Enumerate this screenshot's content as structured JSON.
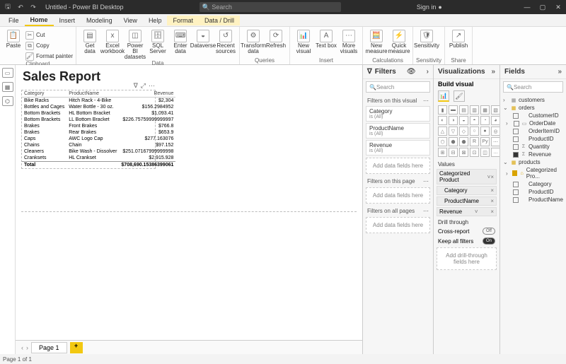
{
  "titlebar": {
    "title": "Untitled - Power BI Desktop",
    "search_placeholder": "Search",
    "signin": "Sign in"
  },
  "tabs": {
    "file": "File",
    "home": "Home",
    "insert": "Insert",
    "modeling": "Modeling",
    "view": "View",
    "help": "Help",
    "format": "Format",
    "datadrill": "Data / Drill"
  },
  "ribbon": {
    "clipboard": {
      "label": "Clipboard",
      "paste": "Paste",
      "cut": "Cut",
      "copy": "Copy",
      "fp": "Format painter"
    },
    "data": {
      "label": "Data",
      "get": "Get data",
      "excel": "Excel workbook",
      "pbids": "Power BI datasets",
      "sql": "SQL Server",
      "enter": "Enter data",
      "dv": "Dataverse",
      "recent": "Recent sources"
    },
    "queries": {
      "label": "Queries",
      "transform": "Transform data",
      "refresh": "Refresh"
    },
    "insert": {
      "label": "Insert",
      "newv": "New visual",
      "text": "Text box",
      "more": "More visuals"
    },
    "calc": {
      "label": "Calculations",
      "nm": "New measure",
      "qm": "Quick measure"
    },
    "sens": {
      "label": "Sensitivity",
      "btn": "Sensitivity"
    },
    "share": {
      "label": "Share",
      "pub": "Publish"
    }
  },
  "report": {
    "title": "Sales Report",
    "cols": {
      "cat": "Category",
      "pn": "ProductName",
      "rev": "Revenue"
    },
    "rows": [
      {
        "c": "Bike Racks",
        "p": "Hitch Rack - 4-Bike",
        "r": "$2,304"
      },
      {
        "c": "Bottles and Cages",
        "p": "Water Bottle - 30 oz.",
        "r": "$156.2984952"
      },
      {
        "c": "Bottom Brackets",
        "p": "HL Bottom Bracket",
        "r": "$1,093.41"
      },
      {
        "c": "Bottom Brackets",
        "p": "LL Bottom Bracket",
        "r": "$226.75759999999997"
      },
      {
        "c": "Brakes",
        "p": "Front Brakes",
        "r": "$766.8"
      },
      {
        "c": "Brakes",
        "p": "Rear Brakes",
        "r": "$653.9"
      },
      {
        "c": "Caps",
        "p": "AWC Logo Cap",
        "r": "$277.163076"
      },
      {
        "c": "Chains",
        "p": "Chain",
        "r": "$97.152"
      },
      {
        "c": "Cleaners",
        "p": "Bike Wash - Dissolver",
        "r": "$251.07167999999998"
      },
      {
        "c": "Cranksets",
        "p": "HL Crankset",
        "r": "$2,915.928"
      }
    ],
    "total_label": "Total",
    "total_value": "$708,690.15386399061"
  },
  "filters": {
    "title": "Filters",
    "search": "Search",
    "visual": "Filters on this visual",
    "page": "Filters on this page",
    "all": "Filters on all pages",
    "isall": "is (All)",
    "adddata": "Add data fields here",
    "f1": "Category",
    "f2": "ProductName",
    "f3": "Revenue"
  },
  "viz": {
    "title": "Visualizations",
    "build": "Build visual",
    "values": "Values",
    "b1": "Categorized Product",
    "b2": "Category",
    "b3": "ProductName",
    "b4": "Revenue",
    "drill": "Drill through",
    "cross": "Cross-report",
    "keep": "Keep all filters",
    "adddrill": "Add drill-through fields here",
    "off": "Off",
    "on": "On"
  },
  "fields": {
    "title": "Fields",
    "search": "Search",
    "t1": "customers",
    "t2": "orders",
    "t3": "products",
    "orders": [
      "CustomerID",
      "OrderDate",
      "OrderItemID",
      "ProductID",
      "Quantity",
      "Revenue"
    ],
    "products": [
      "Categorized Pro...",
      "Category",
      "ProductID",
      "ProductName"
    ]
  },
  "pages": {
    "p1": "Page 1",
    "status": "Page 1 of 1"
  }
}
